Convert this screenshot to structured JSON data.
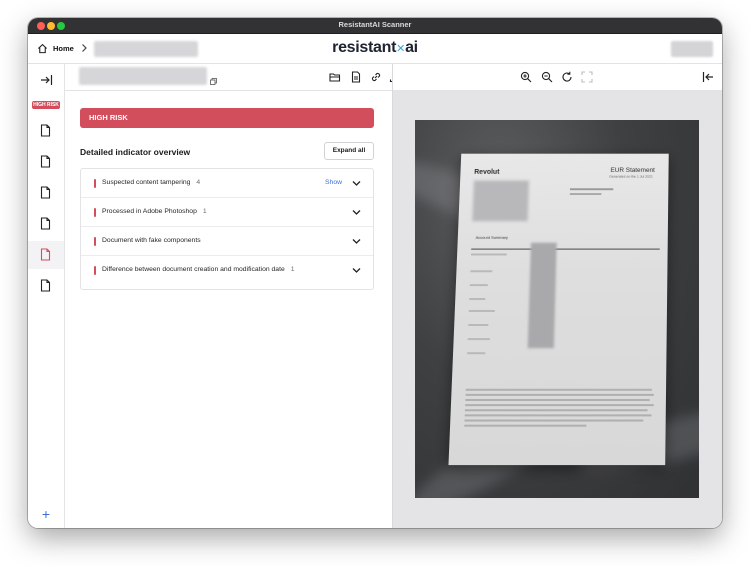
{
  "window": {
    "title": "ResistantAI Scanner"
  },
  "topnav": {
    "home": "Home",
    "logo_left": "resistant",
    "logo_x": "✕",
    "logo_right": "ai"
  },
  "rail": {
    "risk_badge": "HIGH RISK",
    "add": "+"
  },
  "risk": {
    "banner": "HIGH RISK"
  },
  "overview": {
    "title": "Detailed indicator overview",
    "expand_all": "Expand all"
  },
  "indicators": [
    {
      "label": "Suspected content tampering",
      "count": "4",
      "action": "Show"
    },
    {
      "label": "Processed in Adobe Photoshop",
      "count": "1",
      "action": ""
    },
    {
      "label": "Document with fake components",
      "count": "",
      "action": ""
    },
    {
      "label": "Difference between document creation and modification date",
      "count": "1",
      "action": ""
    }
  ],
  "document_preview": {
    "brand": "Revolut",
    "title": "EUR Statement",
    "subtitle": "Generated on the 1 Jul 2021",
    "section": "Account Summary"
  },
  "colors": {
    "risk_red": "#d24e5c",
    "link_blue": "#3a6fd8",
    "titlebar": "#323234"
  }
}
